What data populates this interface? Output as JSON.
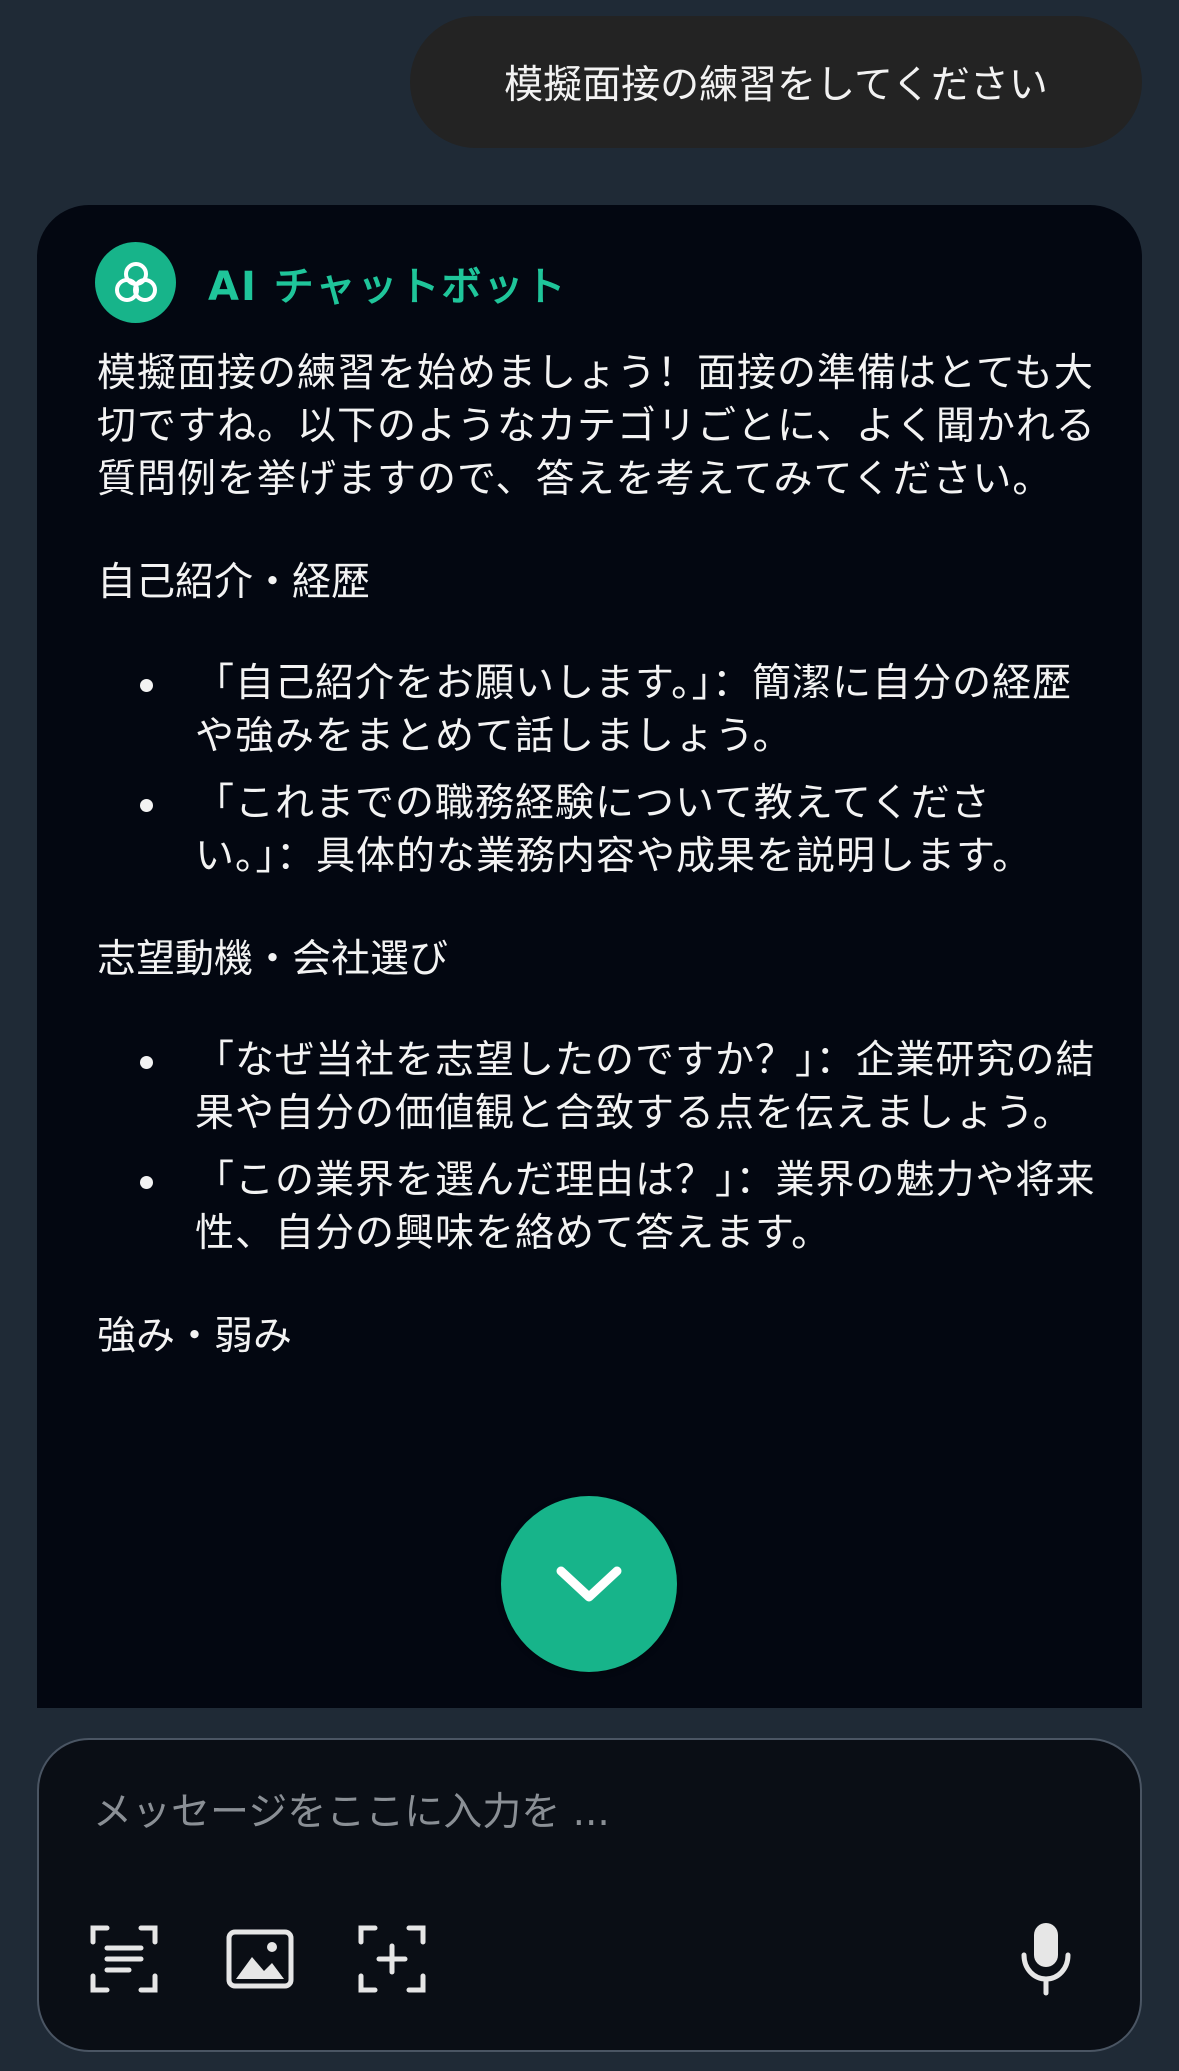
{
  "user_message": "模擬面接の練習をしてください",
  "assistant": {
    "name": "AI チャットボット",
    "intro": "模擬面接の練習を始めましょう！面接の準備はとても大切ですね。以下のようなカテゴリごとに、よく聞かれる質問例を挙げますので、答えを考えてみてください。",
    "sections": [
      {
        "title": "自己紹介・経歴",
        "items": [
          "「自己紹介をお願いします。」：簡潔に自分の経歴や強みをまとめて話しましょう。",
          "「これまでの職務経験について教えてください。」：具体的な業務内容や成果を説明します。"
        ]
      },
      {
        "title": "志望動機・会社選び",
        "items": [
          "「なぜ当社を志望したのですか？」：企業研究の結果や自分の価値観と合致する点を伝えましょう。",
          "「この業界を選んだ理由は？」：業界の魅力や将来性、自分の興味を絡めて答えます。"
        ]
      },
      {
        "title": "強み・弱み",
        "items": []
      }
    ]
  },
  "composer": {
    "placeholder": "メッセージをここに入力を ..."
  },
  "icons": {
    "logo": "swirl-logo-icon",
    "scroll_down": "chevron-down-icon",
    "text_scan": "text-scan-icon",
    "image": "image-icon",
    "add": "add-frame-icon",
    "mic": "microphone-icon"
  },
  "colors": {
    "accent": "#17b48a",
    "background": "#1f2a36",
    "card": "#030711"
  }
}
